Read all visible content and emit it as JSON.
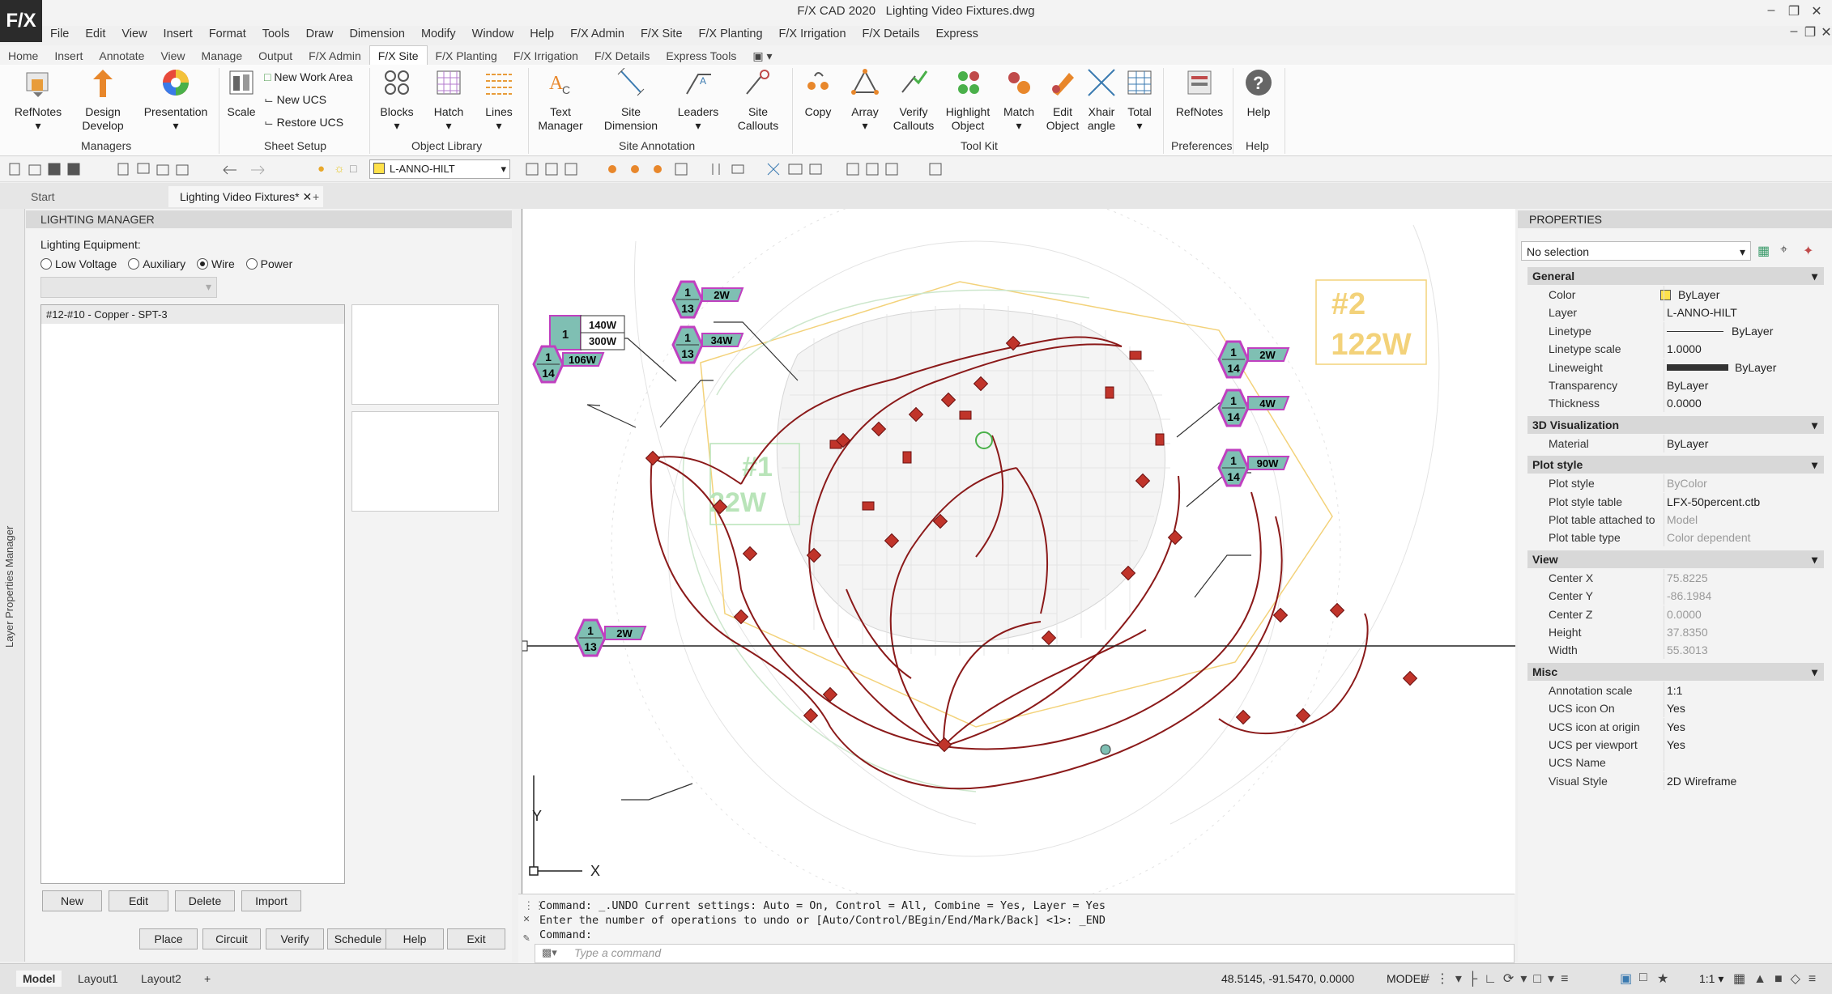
{
  "window": {
    "app": "F/X CAD 2020",
    "file": "Lighting Video Fixtures.dwg",
    "logo": "F/X"
  },
  "menubar": [
    "File",
    "Edit",
    "View",
    "Insert",
    "Format",
    "Tools",
    "Draw",
    "Dimension",
    "Modify",
    "Window",
    "Help",
    "F/X Admin",
    "F/X Site",
    "F/X Planting",
    "F/X Irrigation",
    "F/X Details",
    "Express"
  ],
  "ribbon_tabs": [
    "Home",
    "Insert",
    "Annotate",
    "View",
    "Manage",
    "Output",
    "F/X Admin",
    "F/X Site",
    "F/X Planting",
    "F/X Irrigation",
    "F/X Details",
    "Express Tools"
  ],
  "ribbon_active_tab": "F/X Site",
  "ribbon": {
    "refnotes": "RefNotes",
    "design_develop_1": "Design",
    "design_develop_2": "Develop",
    "presentation": "Presentation",
    "scale": "Scale",
    "new_work_area": "New Work Area",
    "new_ucs": "New UCS",
    "restore_ucs": "Restore UCS",
    "blocks": "Blocks",
    "hatch": "Hatch",
    "lines": "Lines",
    "text_manager_1": "Text",
    "text_manager_2": "Manager",
    "site_dimension_1": "Site",
    "site_dimension_2": "Dimension",
    "leaders": "Leaders",
    "site_callouts_1": "Site",
    "site_callouts_2": "Callouts",
    "copy": "Copy",
    "array": "Array",
    "verify_callouts_1": "Verify",
    "verify_callouts_2": "Callouts",
    "highlight_object_1": "Highlight",
    "highlight_object_2": "Object",
    "match": "Match",
    "edit_object_1": "Edit",
    "edit_object_2": "Object",
    "xhair_angle_1": "Xhair",
    "xhair_angle_2": "angle",
    "total": "Total",
    "refnotes2": "RefNotes",
    "help": "Help",
    "groups": [
      "Managers",
      "Sheet Setup",
      "Object Library",
      "Site Annotation",
      "Tool Kit",
      "Preferences",
      "Help"
    ]
  },
  "quick_toolbar": {
    "layer": "L-ANNO-HILT"
  },
  "doc_tabs": {
    "start": "Start",
    "active": "Lighting Video Fixtures*"
  },
  "lighting_manager": {
    "title": "LIGHTING MANAGER",
    "side_label": "Layer Properties Manager",
    "equipment_label": "Lighting Equipment:",
    "options": [
      "Low Voltage",
      "Auxiliary",
      "Wire",
      "Power"
    ],
    "selected_option": "Wire",
    "list_items": [
      "#12-#10 - Copper - SPT-3"
    ],
    "buttons_row1": [
      "New",
      "Edit",
      "Delete",
      "Import"
    ],
    "buttons_row2": [
      "Place",
      "Circuit",
      "Verify",
      "Schedule",
      "Help",
      "Exit"
    ]
  },
  "drawing": {
    "zone1_num": "#1",
    "zone1_watt": "22W",
    "zone2_num": "#2",
    "zone2_watt": "122W",
    "axis_y": "Y",
    "axis_x": "X",
    "tags": [
      {
        "top": "1",
        "bottom": "",
        "watt1": "140W",
        "watt2": "300W"
      },
      {
        "top": "1",
        "bottom": "13",
        "watt1": "2W"
      },
      {
        "top": "1",
        "bottom": "13",
        "watt1": "34W"
      },
      {
        "top": "1",
        "bottom": "14",
        "watt1": "106W"
      },
      {
        "top": "1",
        "bottom": "14",
        "watt1": "2W"
      },
      {
        "top": "1",
        "bottom": "14",
        "watt1": "4W"
      },
      {
        "top": "1",
        "bottom": "14",
        "watt1": "90W"
      },
      {
        "top": "1",
        "bottom": "13",
        "watt1": "2W"
      }
    ]
  },
  "command": {
    "line1": "Command: _.UNDO Current settings: Auto = On, Control = All, Combine = Yes, Layer = Yes",
    "line2": "Enter the number of operations to undo or [Auto/Control/BEgin/End/Mark/Back] <1>: _END",
    "line3": "Command:",
    "placeholder": "Type a command"
  },
  "properties": {
    "title": "PROPERTIES",
    "selection": "No selection",
    "sections": [
      {
        "name": "General",
        "rows": [
          [
            "Color",
            "ByLayer"
          ],
          [
            "Layer",
            "L-ANNO-HILT"
          ],
          [
            "Linetype",
            "ByLayer"
          ],
          [
            "Linetype scale",
            "1.0000"
          ],
          [
            "Lineweight",
            "ByLayer"
          ],
          [
            "Transparency",
            "ByLayer"
          ],
          [
            "Thickness",
            "0.0000"
          ]
        ]
      },
      {
        "name": "3D Visualization",
        "rows": [
          [
            "Material",
            "ByLayer"
          ]
        ]
      },
      {
        "name": "Plot style",
        "rows": [
          [
            "Plot style",
            "ByColor"
          ],
          [
            "Plot style table",
            "LFX-50percent.ctb"
          ],
          [
            "Plot table attached to",
            "Model"
          ],
          [
            "Plot table type",
            "Color dependent"
          ]
        ]
      },
      {
        "name": "View",
        "rows": [
          [
            "Center X",
            "75.8225"
          ],
          [
            "Center Y",
            "-86.1984"
          ],
          [
            "Center Z",
            "0.0000"
          ],
          [
            "Height",
            "37.8350"
          ],
          [
            "Width",
            "55.3013"
          ]
        ]
      },
      {
        "name": "Misc",
        "rows": [
          [
            "Annotation scale",
            "1:1"
          ],
          [
            "UCS icon On",
            "Yes"
          ],
          [
            "UCS icon at origin",
            "Yes"
          ],
          [
            "UCS per viewport",
            "Yes"
          ],
          [
            "UCS Name",
            ""
          ],
          [
            "Visual Style",
            "2D Wireframe"
          ]
        ]
      }
    ]
  },
  "status": {
    "tabs": [
      "Model",
      "Layout1",
      "Layout2"
    ],
    "coords": "48.5145, -91.5470, 0.0000",
    "mode": "MODEL",
    "scale": "1:1"
  },
  "colors": {
    "wire": "#8b1a1a",
    "tag_fill": "#7fbfb3",
    "tag_border": "#c040c0",
    "zone_yellow": "#f3d27a",
    "zone_green": "#b9e4b9"
  }
}
